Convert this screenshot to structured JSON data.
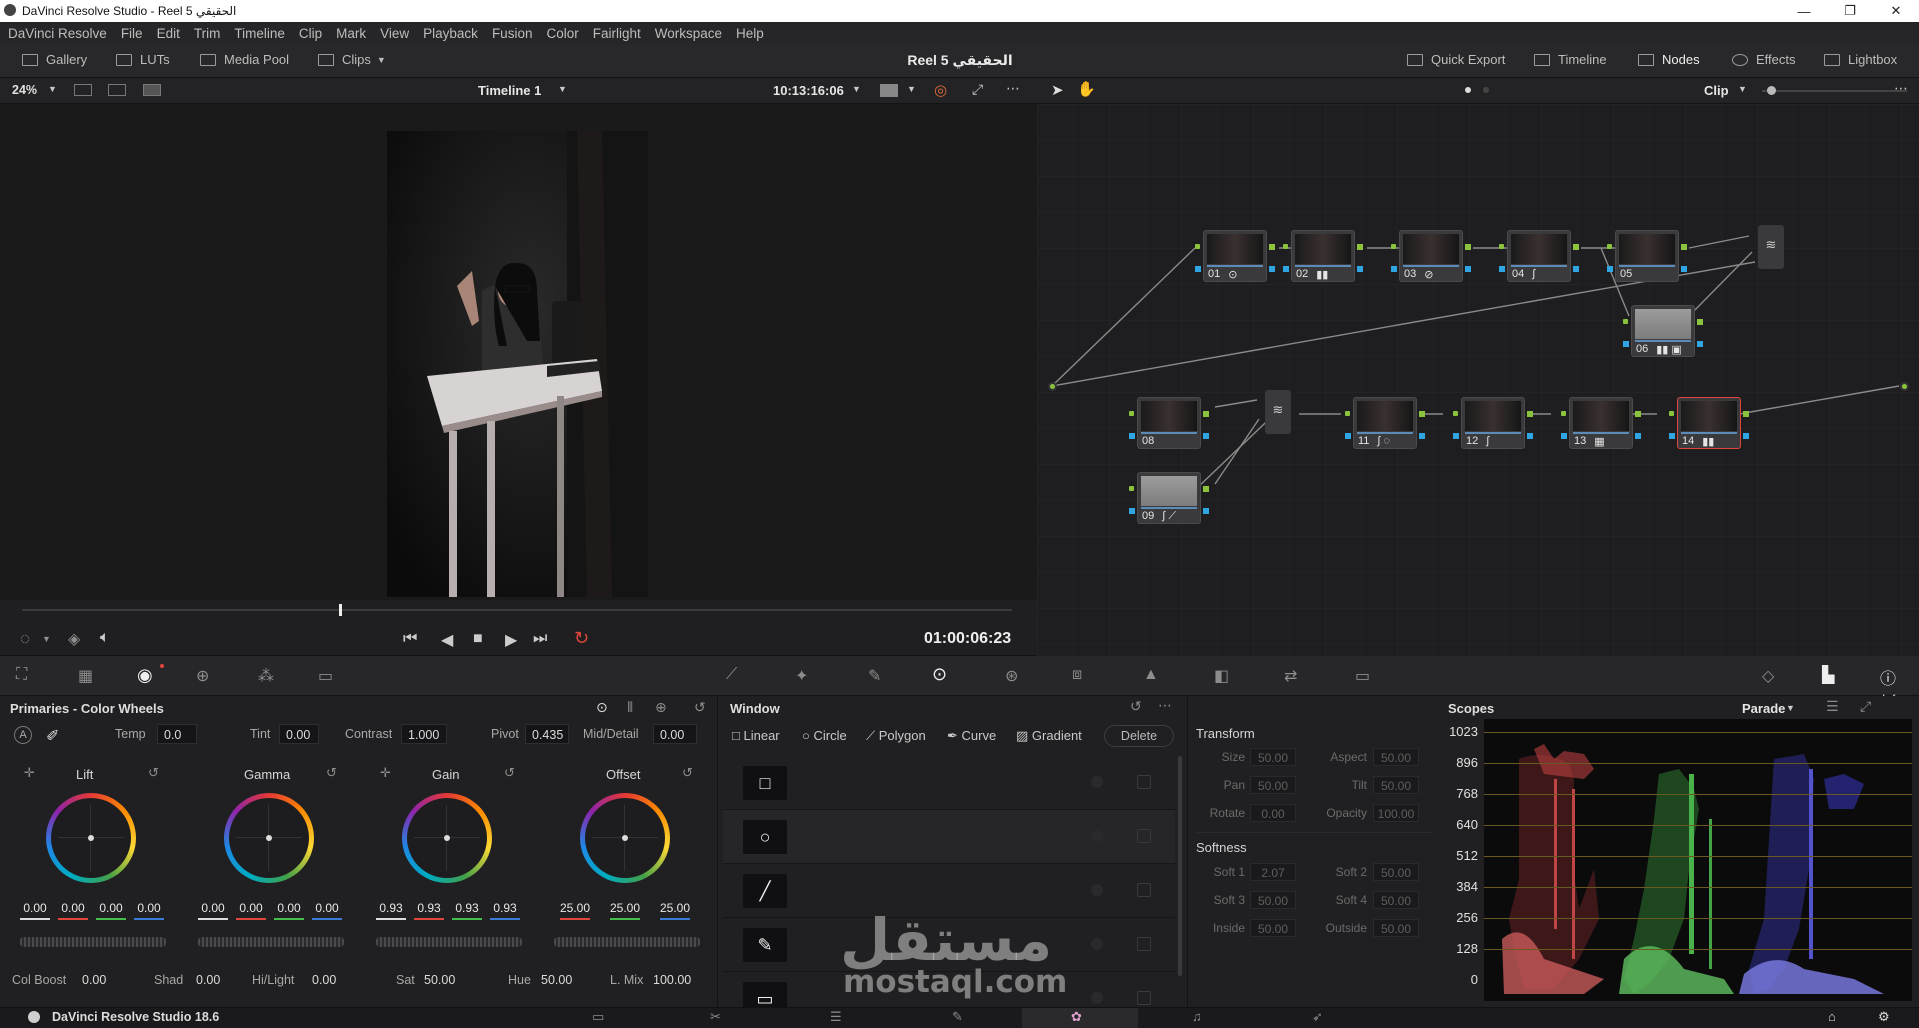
{
  "window": {
    "title": "DaVinci Resolve Studio - Reel 5 الحقيقي",
    "minimize": "—",
    "maximize": "❐",
    "close": "✕"
  },
  "menu": [
    "DaVinci Resolve",
    "File",
    "Edit",
    "Trim",
    "Timeline",
    "Clip",
    "Mark",
    "View",
    "Playback",
    "Fusion",
    "Color",
    "Fairlight",
    "Workspace",
    "Help"
  ],
  "toolbar": {
    "gallery": "Gallery",
    "luts": "LUTs",
    "media_pool": "Media Pool",
    "clips": "Clips",
    "project_title": "Reel 5 الحقيقي",
    "quick_export": "Quick Export",
    "timeline": "Timeline",
    "nodes": "Nodes",
    "effects": "Effects",
    "lightbox": "Lightbox"
  },
  "viewer": {
    "zoom": "24%",
    "timeline_name": "Timeline 1",
    "timecode_top": "10:13:16:06",
    "timecode": "01:00:06:23",
    "playhead_fraction": 0.32
  },
  "nodes_bar": {
    "mode": "Clip"
  },
  "nodes": [
    {
      "id": "01",
      "icons": "⊙"
    },
    {
      "id": "02",
      "icons": "▮▮"
    },
    {
      "id": "03",
      "icons": "⊘"
    },
    {
      "id": "04",
      "icons": "∫"
    },
    {
      "id": "05",
      "icons": ""
    },
    {
      "id": "06",
      "icons": "▮▮ ▣"
    },
    {
      "id": "08",
      "icons": ""
    },
    {
      "id": "09",
      "icons": "∫ ⟋"
    },
    {
      "id": "11",
      "icons": "∫ ◌"
    },
    {
      "id": "12",
      "icons": "∫"
    },
    {
      "id": "13",
      "icons": "▦"
    },
    {
      "id": "14",
      "icons": "▮▮"
    }
  ],
  "primaries": {
    "title": "Primaries - Color Wheels",
    "temp_label": "Temp",
    "temp": "0.0",
    "tint_label": "Tint",
    "tint": "0.00",
    "contrast_label": "Contrast",
    "contrast": "1.000",
    "pivot_label": "Pivot",
    "pivot": "0.435",
    "middetail_label": "Mid/Detail",
    "middetail": "0.00",
    "wheels": [
      {
        "name": "Lift",
        "values": [
          "0.00",
          "0.00",
          "0.00",
          "0.00"
        ]
      },
      {
        "name": "Gamma",
        "values": [
          "0.00",
          "0.00",
          "0.00",
          "0.00"
        ]
      },
      {
        "name": "Gain",
        "values": [
          "0.93",
          "0.93",
          "0.93",
          "0.93"
        ]
      },
      {
        "name": "Offset",
        "values": [
          "25.00",
          "25.00",
          "25.00"
        ]
      }
    ],
    "colboost_label": "Col Boost",
    "colboost": "0.00",
    "shad_label": "Shad",
    "shad": "0.00",
    "hilight_label": "Hi/Light",
    "hilight": "0.00",
    "sat_label": "Sat",
    "sat": "50.00",
    "hue_label": "Hue",
    "hue": "50.00",
    "lmix_label": "L. Mix",
    "lmix": "100.00"
  },
  "window_panel": {
    "title": "Window",
    "tools": [
      "Linear",
      "Circle",
      "Polygon",
      "Curve",
      "Gradient"
    ],
    "delete": "Delete",
    "shapes": [
      "□",
      "○",
      "╱",
      "✎",
      "▭"
    ]
  },
  "transform": {
    "title": "Transform",
    "rows": [
      [
        {
          "l": "Size",
          "v": "50.00"
        },
        {
          "l": "Aspect",
          "v": "50.00"
        }
      ],
      [
        {
          "l": "Pan",
          "v": "50.00"
        },
        {
          "l": "Tilt",
          "v": "50.00"
        }
      ],
      [
        {
          "l": "Rotate",
          "v": "0.00"
        },
        {
          "l": "Opacity",
          "v": "100.00"
        }
      ]
    ],
    "softness_title": "Softness",
    "softness_rows": [
      [
        {
          "l": "Soft 1",
          "v": "2.07"
        },
        {
          "l": "Soft 2",
          "v": "50.00"
        }
      ],
      [
        {
          "l": "Soft 3",
          "v": "50.00"
        },
        {
          "l": "Soft 4",
          "v": "50.00"
        }
      ],
      [
        {
          "l": "Inside",
          "v": "50.00"
        },
        {
          "l": "Outside",
          "v": "50.00"
        }
      ]
    ]
  },
  "scopes": {
    "title": "Scopes",
    "mode": "Parade",
    "info": "Info",
    "scale": [
      "1023",
      "896",
      "768",
      "640",
      "512",
      "384",
      "256",
      "128",
      "0"
    ]
  },
  "watermark": {
    "arabic": "مستقل",
    "latin": "mostaql.com"
  },
  "status": {
    "app": "DaVinci Resolve Studio 18.6"
  }
}
